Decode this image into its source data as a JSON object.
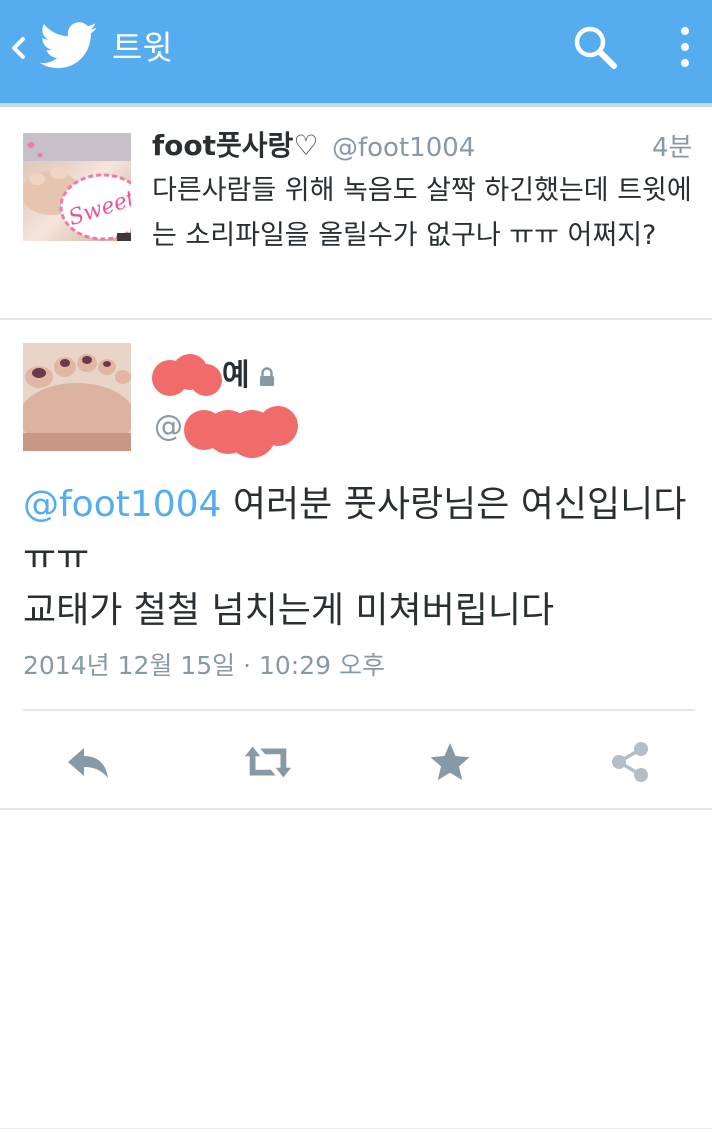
{
  "appbar": {
    "title": "트윗",
    "background": "#55acee",
    "icons": [
      "chevron-left-icon",
      "twitter-bird-icon",
      "search-icon",
      "overflow-menu-icon"
    ]
  },
  "parent_tweet": {
    "name": "foot풋사랑♡",
    "handle": "@foot1004",
    "time": "4분",
    "text": "다른사람들 위해 녹음도 살짝 하긴했는데 트윗에는 소리파일을 올릴수가 없구나 ㅠㅠ 어쩌지?",
    "avatar_badge": "Sweet"
  },
  "focused_tweet": {
    "name_visible": "예",
    "handle_visible": "@",
    "mention": "@foot1004",
    "text": " 여러분 풋사랑님은 여신입니다ㅠㅠ\n교태가 철철 넘치는게 미쳐버립니다",
    "timestamp": "2014년 12월 15일 · 10:29 오후",
    "protected": true
  },
  "actions": [
    "reply-icon",
    "retweet-icon",
    "favorite-star-icon",
    "share-icon"
  ],
  "colors": {
    "accent": "#55acee",
    "muted": "#8899a6",
    "action_icon": "#8899a6",
    "redaction": "#f26b6b"
  }
}
